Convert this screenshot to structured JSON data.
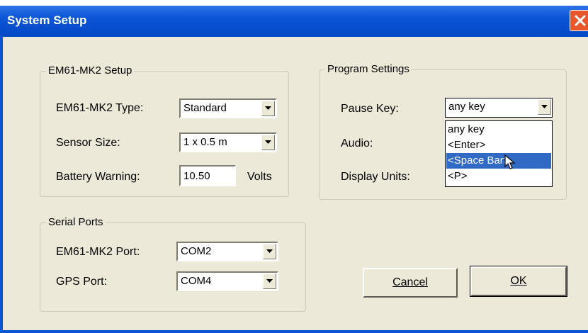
{
  "window": {
    "title": "System Setup"
  },
  "em61_setup": {
    "group_label": "EM61-MK2 Setup",
    "type_label": "EM61-MK2 Type:",
    "type_value": "Standard",
    "sensor_label": "Sensor Size:",
    "sensor_value": "1 x 0.5 m",
    "battery_label": "Battery Warning:",
    "battery_value": "10.50",
    "battery_unit": "Volts"
  },
  "serial_ports": {
    "group_label": "Serial Ports",
    "em61_port_label": "EM61-MK2 Port:",
    "em61_port_value": "COM2",
    "gps_port_label": "GPS Port:",
    "gps_port_value": "COM4"
  },
  "program_settings": {
    "group_label": "Program Settings",
    "pause_key_label": "Pause Key:",
    "pause_key_value": "any key",
    "audio_label": "Audio:",
    "display_units_label": "Display Units:",
    "pause_key_options": [
      "any key",
      "<Enter>",
      "<Space Bar>",
      "<P>"
    ],
    "pause_key_highlighted": "<Space Bar>"
  },
  "buttons": {
    "cancel": "Cancel",
    "ok": "OK"
  },
  "colors": {
    "titlebar": "#0a55d6",
    "dialog_bg": "#ece9d8",
    "selection": "#316ac5",
    "close_button": "#e8572c"
  },
  "icons": {
    "close": "close-icon",
    "dropdown_arrow": "chevron-down-icon",
    "cursor": "mouse-pointer-icon"
  }
}
